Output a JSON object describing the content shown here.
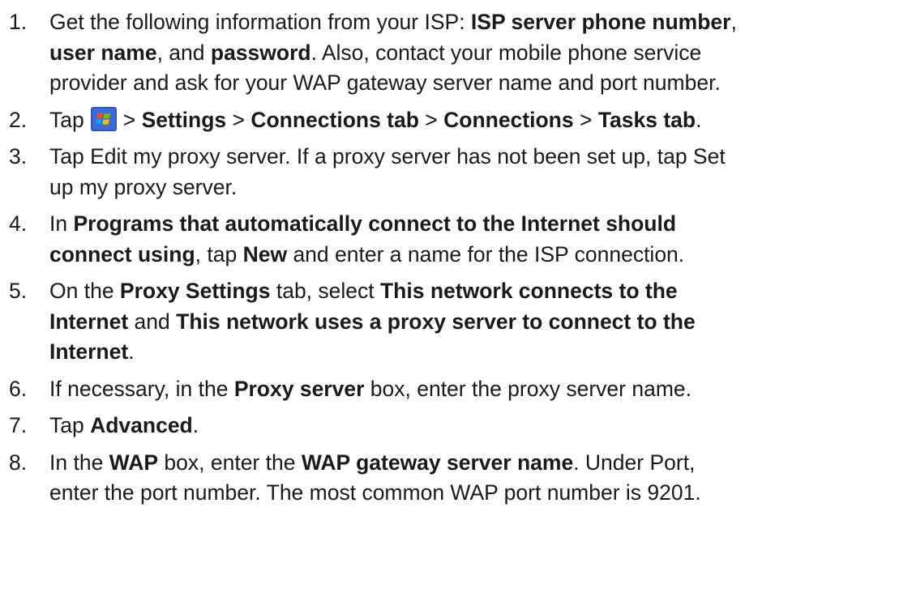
{
  "steps": [
    {
      "number": "1.",
      "segments": [
        {
          "t": "Get the following information from your ISP: ",
          "b": false
        },
        {
          "t": "ISP server phone number",
          "b": true
        },
        {
          "t": ",",
          "b": false
        },
        {
          "t": "\n",
          "br": true
        },
        {
          "t": "user name",
          "b": true
        },
        {
          "t": ", and ",
          "b": false
        },
        {
          "t": "password",
          "b": true
        },
        {
          "t": ". Also, contact your mobile phone service",
          "b": false
        },
        {
          "t": "\n",
          "br": true
        },
        {
          "t": "provider and ask for your WAP gateway server name and port number.",
          "b": false
        }
      ]
    },
    {
      "number": "2.",
      "segments": [
        {
          "t": "Tap",
          "b": false
        },
        {
          "icon": "windows-start-icon"
        },
        {
          "t": "> ",
          "b": false
        },
        {
          "t": "Settings",
          "b": true
        },
        {
          "t": " > ",
          "b": false
        },
        {
          "t": "Connections tab",
          "b": true
        },
        {
          "t": " > ",
          "b": false
        },
        {
          "t": "Connections",
          "b": true
        },
        {
          "t": " > ",
          "b": false
        },
        {
          "t": "Tasks tab",
          "b": true
        },
        {
          "t": ".",
          "b": false
        }
      ]
    },
    {
      "number": "3.",
      "segments": [
        {
          "t": "Tap Edit my proxy server. If a proxy server has not been set up, tap Set",
          "b": false
        },
        {
          "t": "\n",
          "br": true
        },
        {
          "t": "up my proxy server.",
          "b": false
        }
      ]
    },
    {
      "number": "4.",
      "segments": [
        {
          "t": "In ",
          "b": false
        },
        {
          "t": "Programs that automatically connect to the Internet should",
          "b": true
        },
        {
          "t": "\n",
          "br": true
        },
        {
          "t": "connect using",
          "b": true
        },
        {
          "t": ", tap ",
          "b": false
        },
        {
          "t": "New",
          "b": true
        },
        {
          "t": " and enter a name for the ISP connection.",
          "b": false
        }
      ]
    },
    {
      "number": "5.",
      "segments": [
        {
          "t": "On the ",
          "b": false
        },
        {
          "t": "Proxy Settings",
          "b": true
        },
        {
          "t": " tab, select ",
          "b": false
        },
        {
          "t": "This network connects to the",
          "b": true
        },
        {
          "t": "\n",
          "br": true
        },
        {
          "t": "Internet",
          "b": true
        },
        {
          "t": " and ",
          "b": false
        },
        {
          "t": "This network uses a proxy server to connect to the",
          "b": true
        },
        {
          "t": "\n",
          "br": true
        },
        {
          "t": "Internet",
          "b": true
        },
        {
          "t": ".",
          "b": false
        }
      ]
    },
    {
      "number": "6.",
      "segments": [
        {
          "t": "If necessary, in the ",
          "b": false
        },
        {
          "t": "Proxy server",
          "b": true
        },
        {
          "t": " box, enter the proxy server name.",
          "b": false
        }
      ]
    },
    {
      "number": "7.",
      "segments": [
        {
          "t": "Tap ",
          "b": false
        },
        {
          "t": "Advanced",
          "b": true
        },
        {
          "t": ".",
          "b": false
        }
      ]
    },
    {
      "number": "8.",
      "segments": [
        {
          "t": "In the ",
          "b": false
        },
        {
          "t": "WAP",
          "b": true
        },
        {
          "t": " box, enter the ",
          "b": false
        },
        {
          "t": "WAP gateway server name",
          "b": true
        },
        {
          "t": ". Under Port,",
          "b": false
        },
        {
          "t": "\n",
          "br": true
        },
        {
          "t": "enter the port number. The most common WAP port number is 9201.",
          "b": false
        }
      ]
    }
  ]
}
